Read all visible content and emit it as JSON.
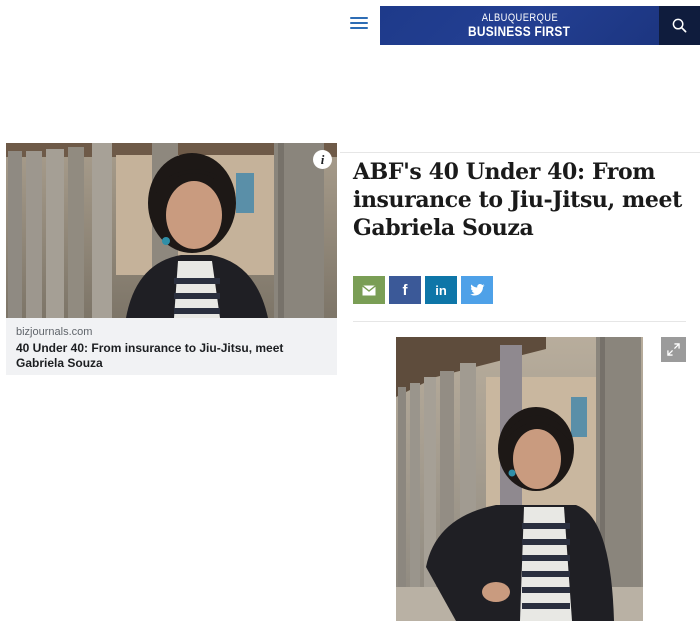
{
  "header": {
    "brand_line1": "ALBUQUERQUE",
    "brand_line2": "BUSINESS FIRST",
    "menu_icon": "hamburger-icon",
    "search_icon": "search-icon",
    "brand_color": "#1e3a8a"
  },
  "preview_card": {
    "domain": "bizjournals.com",
    "title": "40 Under 40: From insurance to Jiu-Jitsu, meet Gabriela Souza",
    "info_icon": "info-icon"
  },
  "article": {
    "headline": "ABF's 40 Under 40: From insurance to Jiu-Jitsu, meet Gabriela Souza",
    "share_buttons": [
      {
        "name": "email",
        "icon": "envelope-icon",
        "color": "#7a9e55"
      },
      {
        "name": "facebook",
        "glyph": "f",
        "icon": "facebook-icon",
        "color": "#3b5998"
      },
      {
        "name": "linkedin",
        "glyph": "in",
        "icon": "linkedin-icon",
        "color": "#0e76a8"
      },
      {
        "name": "twitter",
        "icon": "twitter-icon",
        "color": "#4ea1e8"
      }
    ],
    "expand_icon": "expand-icon"
  }
}
